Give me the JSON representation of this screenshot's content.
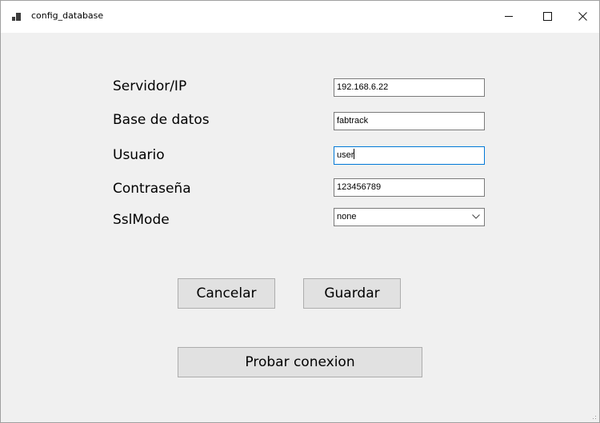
{
  "window": {
    "title": "config_database",
    "icon": "app-window-icon",
    "controls": [
      "minimize-icon",
      "maximize-icon",
      "close-icon"
    ]
  },
  "form": {
    "server_label": "Servidor/IP",
    "server_value": "192.168.6.22",
    "database_label": "Base de datos",
    "database_value": "fabtrack",
    "user_label": "Usuario",
    "user_value": "user",
    "password_label": "Contraseña",
    "password_value": "123456789",
    "sslmode_label": "SslMode",
    "sslmode_value": "none"
  },
  "buttons": {
    "cancel": "Cancelar",
    "save": "Guardar",
    "test": "Probar conexion"
  },
  "colors": {
    "focus_border": "#0078d7",
    "window_bg": "#f0f0f0",
    "button_bg": "#e1e1e1"
  }
}
